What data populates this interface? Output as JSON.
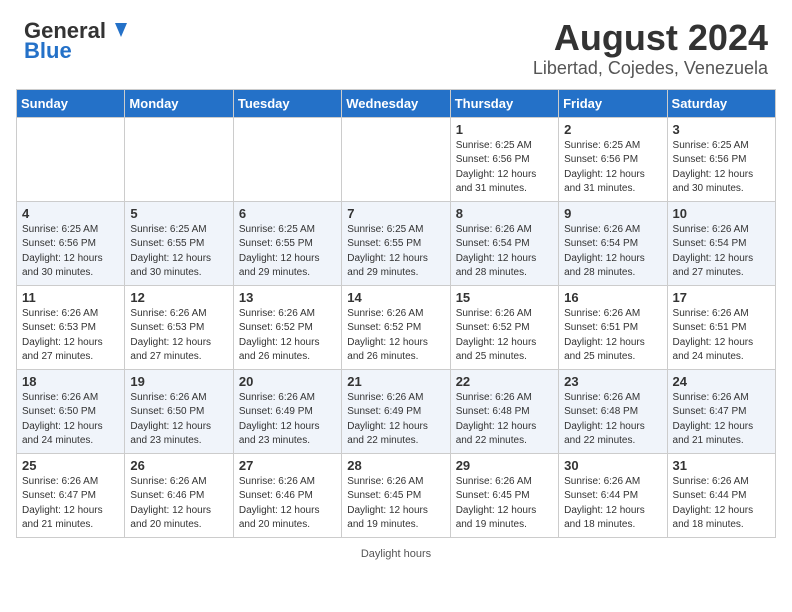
{
  "header": {
    "logo_general": "General",
    "logo_blue": "Blue",
    "main_title": "August 2024",
    "subtitle": "Libertad, Cojedes, Venezuela"
  },
  "days_of_week": [
    "Sunday",
    "Monday",
    "Tuesday",
    "Wednesday",
    "Thursday",
    "Friday",
    "Saturday"
  ],
  "weeks": [
    [
      {
        "day": "",
        "info": ""
      },
      {
        "day": "",
        "info": ""
      },
      {
        "day": "",
        "info": ""
      },
      {
        "day": "",
        "info": ""
      },
      {
        "day": "1",
        "info": "Sunrise: 6:25 AM\nSunset: 6:56 PM\nDaylight: 12 hours\nand 31 minutes."
      },
      {
        "day": "2",
        "info": "Sunrise: 6:25 AM\nSunset: 6:56 PM\nDaylight: 12 hours\nand 31 minutes."
      },
      {
        "day": "3",
        "info": "Sunrise: 6:25 AM\nSunset: 6:56 PM\nDaylight: 12 hours\nand 30 minutes."
      }
    ],
    [
      {
        "day": "4",
        "info": "Sunrise: 6:25 AM\nSunset: 6:56 PM\nDaylight: 12 hours\nand 30 minutes."
      },
      {
        "day": "5",
        "info": "Sunrise: 6:25 AM\nSunset: 6:55 PM\nDaylight: 12 hours\nand 30 minutes."
      },
      {
        "day": "6",
        "info": "Sunrise: 6:25 AM\nSunset: 6:55 PM\nDaylight: 12 hours\nand 29 minutes."
      },
      {
        "day": "7",
        "info": "Sunrise: 6:25 AM\nSunset: 6:55 PM\nDaylight: 12 hours\nand 29 minutes."
      },
      {
        "day": "8",
        "info": "Sunrise: 6:26 AM\nSunset: 6:54 PM\nDaylight: 12 hours\nand 28 minutes."
      },
      {
        "day": "9",
        "info": "Sunrise: 6:26 AM\nSunset: 6:54 PM\nDaylight: 12 hours\nand 28 minutes."
      },
      {
        "day": "10",
        "info": "Sunrise: 6:26 AM\nSunset: 6:54 PM\nDaylight: 12 hours\nand 27 minutes."
      }
    ],
    [
      {
        "day": "11",
        "info": "Sunrise: 6:26 AM\nSunset: 6:53 PM\nDaylight: 12 hours\nand 27 minutes."
      },
      {
        "day": "12",
        "info": "Sunrise: 6:26 AM\nSunset: 6:53 PM\nDaylight: 12 hours\nand 27 minutes."
      },
      {
        "day": "13",
        "info": "Sunrise: 6:26 AM\nSunset: 6:52 PM\nDaylight: 12 hours\nand 26 minutes."
      },
      {
        "day": "14",
        "info": "Sunrise: 6:26 AM\nSunset: 6:52 PM\nDaylight: 12 hours\nand 26 minutes."
      },
      {
        "day": "15",
        "info": "Sunrise: 6:26 AM\nSunset: 6:52 PM\nDaylight: 12 hours\nand 25 minutes."
      },
      {
        "day": "16",
        "info": "Sunrise: 6:26 AM\nSunset: 6:51 PM\nDaylight: 12 hours\nand 25 minutes."
      },
      {
        "day": "17",
        "info": "Sunrise: 6:26 AM\nSunset: 6:51 PM\nDaylight: 12 hours\nand 24 minutes."
      }
    ],
    [
      {
        "day": "18",
        "info": "Sunrise: 6:26 AM\nSunset: 6:50 PM\nDaylight: 12 hours\nand 24 minutes."
      },
      {
        "day": "19",
        "info": "Sunrise: 6:26 AM\nSunset: 6:50 PM\nDaylight: 12 hours\nand 23 minutes."
      },
      {
        "day": "20",
        "info": "Sunrise: 6:26 AM\nSunset: 6:49 PM\nDaylight: 12 hours\nand 23 minutes."
      },
      {
        "day": "21",
        "info": "Sunrise: 6:26 AM\nSunset: 6:49 PM\nDaylight: 12 hours\nand 22 minutes."
      },
      {
        "day": "22",
        "info": "Sunrise: 6:26 AM\nSunset: 6:48 PM\nDaylight: 12 hours\nand 22 minutes."
      },
      {
        "day": "23",
        "info": "Sunrise: 6:26 AM\nSunset: 6:48 PM\nDaylight: 12 hours\nand 22 minutes."
      },
      {
        "day": "24",
        "info": "Sunrise: 6:26 AM\nSunset: 6:47 PM\nDaylight: 12 hours\nand 21 minutes."
      }
    ],
    [
      {
        "day": "25",
        "info": "Sunrise: 6:26 AM\nSunset: 6:47 PM\nDaylight: 12 hours\nand 21 minutes."
      },
      {
        "day": "26",
        "info": "Sunrise: 6:26 AM\nSunset: 6:46 PM\nDaylight: 12 hours\nand 20 minutes."
      },
      {
        "day": "27",
        "info": "Sunrise: 6:26 AM\nSunset: 6:46 PM\nDaylight: 12 hours\nand 20 minutes."
      },
      {
        "day": "28",
        "info": "Sunrise: 6:26 AM\nSunset: 6:45 PM\nDaylight: 12 hours\nand 19 minutes."
      },
      {
        "day": "29",
        "info": "Sunrise: 6:26 AM\nSunset: 6:45 PM\nDaylight: 12 hours\nand 19 minutes."
      },
      {
        "day": "30",
        "info": "Sunrise: 6:26 AM\nSunset: 6:44 PM\nDaylight: 12 hours\nand 18 minutes."
      },
      {
        "day": "31",
        "info": "Sunrise: 6:26 AM\nSunset: 6:44 PM\nDaylight: 12 hours\nand 18 minutes."
      }
    ]
  ],
  "footer": {
    "daylight_label": "Daylight hours"
  }
}
